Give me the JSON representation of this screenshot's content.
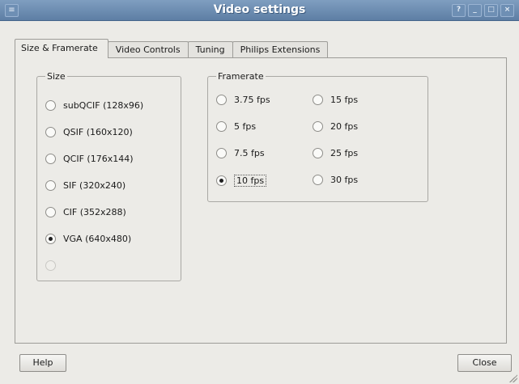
{
  "window": {
    "title": "Video settings",
    "menu_glyph": "≡",
    "buttons": [
      "?",
      "_",
      "□",
      "×"
    ]
  },
  "tabs": [
    {
      "label": "Size & Framerate",
      "underline": "i",
      "active": true
    },
    {
      "label": "Video Controls",
      "underline": "V",
      "active": false
    },
    {
      "label": "Tuning",
      "underline": "T",
      "active": false
    },
    {
      "label": "Philips Extensions",
      "underline": "x",
      "active": false
    }
  ],
  "size_group": {
    "legend": "Size",
    "options": [
      {
        "label": "subQCIF (128x96)",
        "checked": false,
        "disabled": false
      },
      {
        "label": "QSIF (160x120)",
        "checked": false,
        "disabled": false
      },
      {
        "label": "QCIF (176x144)",
        "checked": false,
        "disabled": false
      },
      {
        "label": "SIF (320x240)",
        "checked": false,
        "disabled": false
      },
      {
        "label": "CIF (352x288)",
        "checked": false,
        "disabled": false
      },
      {
        "label": "VGA (640x480)",
        "checked": true,
        "disabled": false
      },
      {
        "label": "",
        "checked": false,
        "disabled": true
      }
    ]
  },
  "framerate_group": {
    "legend": "Framerate",
    "options": [
      {
        "label": "3.75 fps",
        "checked": false
      },
      {
        "label": "5 fps",
        "checked": false
      },
      {
        "label": "7.5 fps",
        "checked": false
      },
      {
        "label": "10 fps",
        "checked": true
      },
      {
        "label": "15 fps",
        "checked": false
      },
      {
        "label": "20 fps",
        "checked": false
      },
      {
        "label": "25 fps",
        "checked": false
      },
      {
        "label": "30 fps",
        "checked": false
      }
    ]
  },
  "footer": {
    "help_label": "Help",
    "close_label": "Close"
  }
}
